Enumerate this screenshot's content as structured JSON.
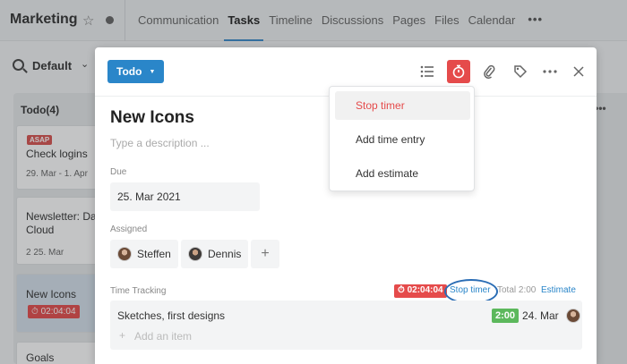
{
  "app": {
    "project_title": "Marketing",
    "nav": [
      "Communication",
      "Tasks",
      "Timeline",
      "Discussions",
      "Pages",
      "Files",
      "Calendar"
    ],
    "nav_more": "•••",
    "filter_label": "Default"
  },
  "board": {
    "column_title": "Todo(4)",
    "cards": [
      {
        "badge": "ASAP",
        "title": "Check logins",
        "meta": "29. Mar - 1. Apr"
      },
      {
        "title": "Newsletter: Da Cloud",
        "meta": "2   25. Mar"
      },
      {
        "title": "New Icons",
        "timer": "02:04:04"
      },
      {
        "title": "Goals"
      }
    ],
    "right_more": "•••"
  },
  "modal": {
    "status": "Todo",
    "title": "New Icons",
    "description_placeholder": "Type a description ...",
    "due_label": "Due",
    "due_value": "25. Mar 2021",
    "assigned_label": "Assigned",
    "assignees": [
      "Steffen",
      "Dennis"
    ],
    "add_assignee": "+",
    "time_tracking": {
      "label": "Time Tracking",
      "running_timer": "02:04:04",
      "stop_label": "Stop timer",
      "total": "Total 2:00",
      "estimate_label": "Estimate",
      "entries": [
        {
          "description": "Sketches, first designs",
          "duration": "2:00",
          "date": "24. Mar"
        }
      ],
      "add_placeholder": "Add an item"
    }
  },
  "dropdown": {
    "items": [
      "Stop timer",
      "Add time entry",
      "Add estimate"
    ]
  },
  "colors": {
    "accent": "#2a86c9",
    "timer_red": "#e54b4b",
    "duration_green": "#5cb85c"
  }
}
